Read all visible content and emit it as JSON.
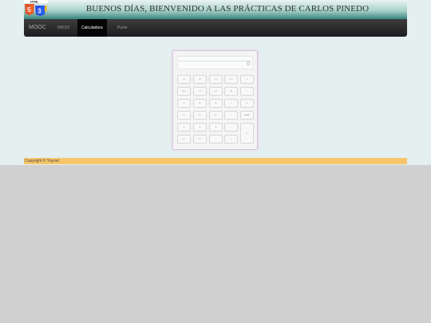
{
  "header": {
    "title": "BUENOS DÍAS, BIENVENIDO A LAS PRÁCTICAS DE CARLOS PINEDO",
    "logo_label": "HTML"
  },
  "nav": {
    "brand": "MOOC",
    "items": [
      "INICIO",
      "Calculadora",
      "Puzle"
    ],
    "active": "Calculadora"
  },
  "calculator": {
    "display_value": "0",
    "keys": [
      [
        "x²",
        "x³",
        "x y",
        "e x",
        "√"
      ],
      [
        "1/x",
        "x!",
        "n!",
        "%",
        "-"
      ],
      [
        "7",
        "8",
        "9",
        "/",
        "±"
      ],
      [
        "4",
        "5",
        "6",
        "*",
        "CE/C"
      ],
      [
        "1",
        "2",
        "3",
        "-",
        "="
      ],
      [
        "+/-",
        "0",
        ".",
        "+"
      ]
    ]
  },
  "footer": {
    "copyright": "Copyright © Yuynet"
  },
  "colors": {
    "background": "#d0d0d0",
    "page": "#e4efef",
    "navbar": "#222222",
    "footer": "#f6c76a",
    "header_gradient_end": "#37837c"
  }
}
